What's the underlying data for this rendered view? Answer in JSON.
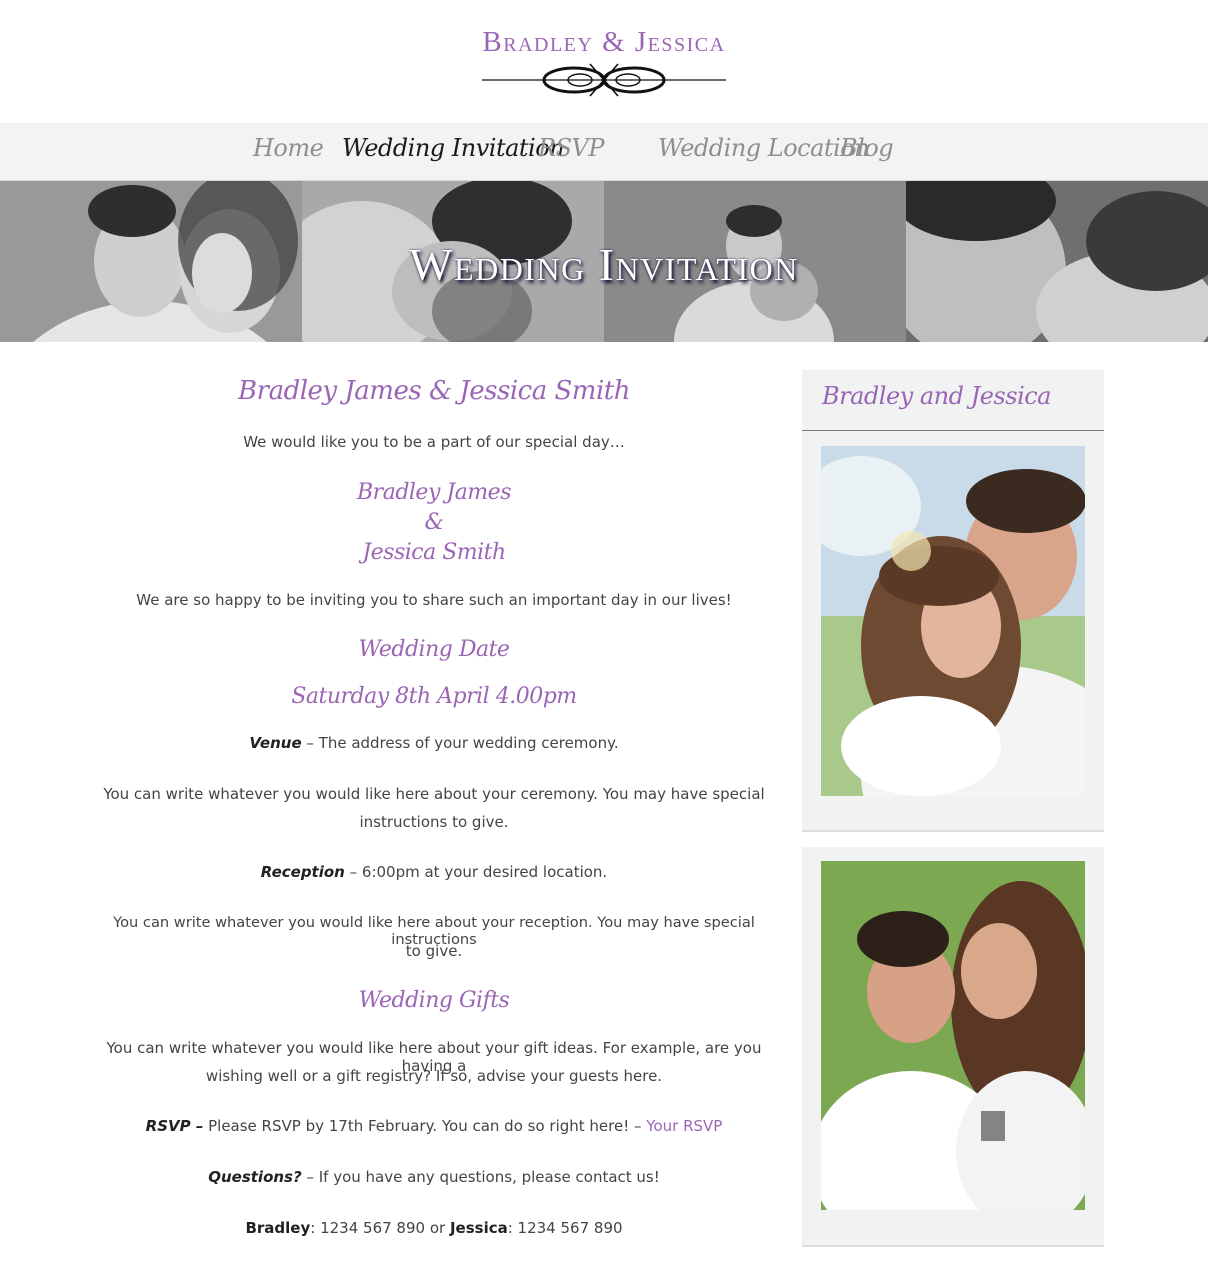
{
  "site": {
    "title": "Bradley & Jessica"
  },
  "nav": {
    "items": [
      {
        "label": "Home",
        "active": false
      },
      {
        "label": "Wedding Invitation",
        "active": true
      },
      {
        "label": "RSVP",
        "active": false
      },
      {
        "label": "Wedding Location",
        "active": false
      },
      {
        "label": "Blog",
        "active": false
      }
    ]
  },
  "banner": {
    "title": "Wedding Invitation"
  },
  "main": {
    "couple_heading": "Bradley James & Jessica Smith",
    "intro": "We would like you to be a part of our special day…",
    "name_1": "Bradley James",
    "ampersand": "&",
    "name_2": "Jessica Smith",
    "happy_line": "We are so happy to be inviting you to share such an important day in our lives!",
    "date_heading": "Wedding Date",
    "date_value": "Saturday 8th April 4.00pm",
    "venue_label": "Venue",
    "venue_text": " – The address of your wedding ceremony.",
    "ceremony_line_1": "You can write whatever you would like here about your ceremony. You may have special",
    "ceremony_line_2": "instructions to give.",
    "reception_label": "Reception",
    "reception_text": " – 6:00pm at your desired location.",
    "reception_line_1": "You can write whatever you would like here about your reception. You may have special instructions",
    "reception_line_2": "to give.",
    "gifts_heading": "Wedding Gifts",
    "gifts_line_1": "You can write whatever you would like here about your gift ideas. For example, are you having a",
    "gifts_line_2": "wishing well or a gift registry? If so, advise your guests here.",
    "rsvp_label": "RSVP –",
    "rsvp_text": " Please RSVP by 17th February. You can do so right here! – ",
    "rsvp_link": "Your RSVP",
    "questions_label": "Questions?",
    "questions_text": " – If you have any questions, please contact us!",
    "contact_name_1": "Bradley",
    "contact_phone_1": ": 1234 567 890 or ",
    "contact_name_2": "Jessica",
    "contact_phone_2": ": 1234 567 890"
  },
  "sidebar": {
    "widget_title": "Bradley and Jessica"
  },
  "colors": {
    "accent": "#9b65b5",
    "nav_background": "#f2f3f3",
    "widget_background": "#f1f2f2"
  }
}
